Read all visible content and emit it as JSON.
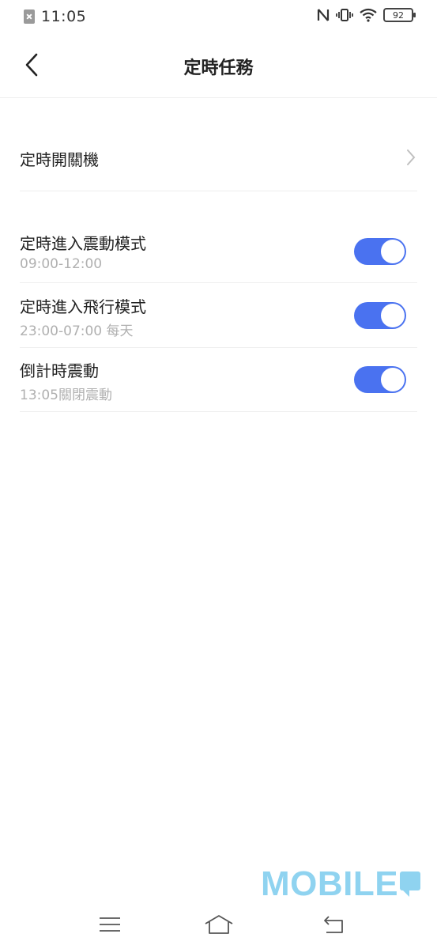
{
  "status_bar": {
    "time": "11:05",
    "battery": "92",
    "icons": [
      "sim-error-icon",
      "nfc-icon",
      "vibrate-icon",
      "wifi-icon",
      "battery-icon"
    ]
  },
  "header": {
    "title": "定時任務",
    "back_icon": "chevron-left-icon"
  },
  "items": [
    {
      "title": "定時開關機",
      "type": "link"
    },
    {
      "title": "定時進入震動模式",
      "subtitle": "09:00-12:00",
      "type": "toggle",
      "enabled": true
    },
    {
      "title": "定時進入飛行模式",
      "subtitle": "23:00-07:00 每天",
      "type": "toggle",
      "enabled": true
    },
    {
      "title": "倒計時震動",
      "subtitle": "13:05關閉震動",
      "type": "toggle",
      "enabled": true
    }
  ],
  "colors": {
    "accent": "#4a72f0",
    "subtitle": "#b0b0b0",
    "watermark": "#8fd3f0"
  },
  "watermark": "MOBILE",
  "nav_bar": {
    "icons": [
      "menu-icon",
      "home-icon",
      "back-icon"
    ]
  }
}
